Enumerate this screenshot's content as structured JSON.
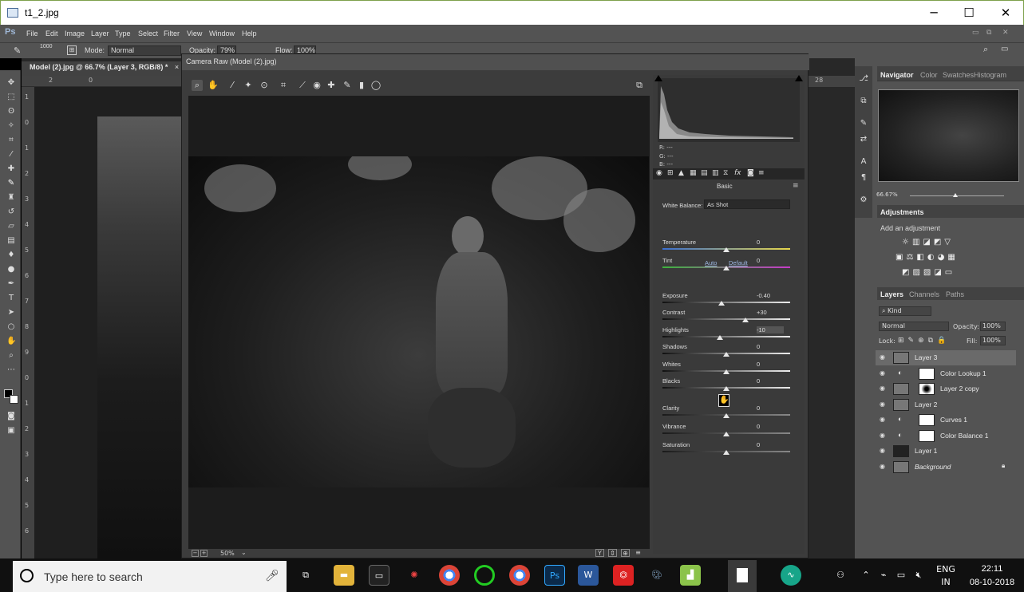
{
  "window": {
    "title": "t1_2.jpg",
    "minimize": "─",
    "maximize": "☐",
    "close": "✕"
  },
  "menubar": {
    "logo": "Ps",
    "items": [
      "File",
      "Edit",
      "Image",
      "Layer",
      "Type",
      "Select",
      "Filter",
      "View",
      "Window",
      "Help"
    ]
  },
  "options": {
    "size": "1000",
    "mode_label": "Mode:",
    "mode_value": "Normal",
    "opacity_label": "Opacity:",
    "opacity_value": "79%",
    "flow_label": "Flow:",
    "flow_value": "100%"
  },
  "document": {
    "tab": "Model (2).jpg @ 66.7% (Layer 3, RGB/8) *",
    "close": "×",
    "ruler_top": [
      "2",
      "0"
    ],
    "ruler_right": "28",
    "ruler_left": [
      "1",
      "0",
      "1",
      "2",
      "3",
      "4",
      "5",
      "6",
      "7",
      "8",
      "9",
      "0",
      "1",
      "2",
      "3",
      "4",
      "5",
      "6"
    ]
  },
  "camera_raw": {
    "title": "Camera Raw (Model (2).jpg)",
    "zoom": "50%",
    "rgb": [
      "R:   ---",
      "G:   ---",
      "B:   ---"
    ],
    "panel_name": "Basic",
    "white_balance_label": "White Balance:",
    "white_balance_value": "As Shot",
    "auto": "Auto",
    "default": "Default",
    "sliders": [
      {
        "name": "Temperature",
        "value": "0",
        "pos": 0.5
      },
      {
        "name": "Tint",
        "value": "0",
        "pos": 0.5
      },
      {
        "name": "Exposure",
        "value": "-0.40",
        "pos": 0.46
      },
      {
        "name": "Contrast",
        "value": "+30",
        "pos": 0.65
      },
      {
        "name": "Highlights",
        "value": "-10",
        "pos": 0.45
      },
      {
        "name": "Shadows",
        "value": "0",
        "pos": 0.5
      },
      {
        "name": "Whites",
        "value": "0",
        "pos": 0.5
      },
      {
        "name": "Blacks",
        "value": "0",
        "pos": 0.5
      },
      {
        "name": "Clarity",
        "value": "0",
        "pos": 0.5
      },
      {
        "name": "Vibrance",
        "value": "0",
        "pos": 0.5
      },
      {
        "name": "Saturation",
        "value": "0",
        "pos": 0.5
      }
    ]
  },
  "navigator": {
    "tabs": [
      "Navigator",
      "Color",
      "Swatches",
      "Histogram"
    ],
    "zoom": "66.67%"
  },
  "adjustments": {
    "title": "Adjustments",
    "subtitle": "Add an adjustment"
  },
  "layers_panel": {
    "tabs": [
      "Layers",
      "Channels",
      "Paths"
    ],
    "filter": "Kind",
    "blend": "Normal",
    "opacity_label": "Opacity:",
    "opacity": "100%",
    "lock_label": "Lock:",
    "fill_label": "Fill:",
    "fill": "100%",
    "layers": [
      "Layer 3",
      "Color Lookup 1",
      "Layer 2 copy",
      "Layer 2",
      "Curves 1",
      "Color Balance 1",
      "Layer 1",
      "Background"
    ]
  },
  "taskbar": {
    "search_placeholder": "Type here to search",
    "lang1": "ENG",
    "lang2": "IN",
    "time": "22:11",
    "date": "08-10-2018"
  }
}
